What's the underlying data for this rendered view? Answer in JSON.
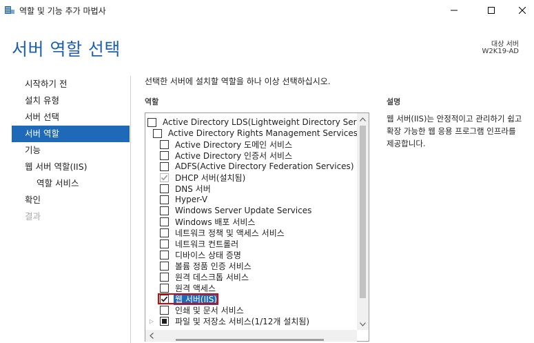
{
  "window": {
    "title": "역할 및 기능 추가 마법사"
  },
  "header": {
    "page_title": "서버 역할 선택",
    "target_label": "대상 서버",
    "target_server": "W2K19-AD"
  },
  "nav": {
    "items": [
      {
        "label": "시작하기 전",
        "state": "normal"
      },
      {
        "label": "설치 유형",
        "state": "normal"
      },
      {
        "label": "서버 선택",
        "state": "normal"
      },
      {
        "label": "서버 역할",
        "state": "active"
      },
      {
        "label": "기능",
        "state": "normal"
      },
      {
        "label": "웹 서버 역할(IIS)",
        "state": "normal"
      },
      {
        "label": "역할 서비스",
        "state": "sub"
      },
      {
        "label": "확인",
        "state": "normal"
      },
      {
        "label": "결과",
        "state": "disabled"
      }
    ]
  },
  "main": {
    "instruction": "선택한 서버에 설치할 역할을 하나 이상 선택하십시오.",
    "roles_heading": "역할",
    "description_heading": "설명",
    "description_text": "웹 서버(IIS)는 안정적이고 관리하기 쉽고 확장 가능한 웹 응용 프로그램 인프라를 제공합니다.",
    "roles": [
      {
        "label": "Active Directory LDS(Lightweight Directory Services)",
        "checked": false
      },
      {
        "label": "Active Directory Rights Management Services",
        "checked": false
      },
      {
        "label": "Active Directory 도메인 서비스",
        "checked": false
      },
      {
        "label": "Active Directory 인증서 서비스",
        "checked": false
      },
      {
        "label": "ADFS(Active Directory Federation Services)",
        "checked": false
      },
      {
        "label": "DHCP 서버(설치됨)",
        "checked": "disabled"
      },
      {
        "label": "DNS 서버",
        "checked": false
      },
      {
        "label": "Hyper-V",
        "checked": false
      },
      {
        "label": "Windows Server Update Services",
        "checked": false
      },
      {
        "label": "Windows 배포 서비스",
        "checked": false
      },
      {
        "label": "네트워크 정책 및 액세스 서비스",
        "checked": false
      },
      {
        "label": "네트워크 컨트롤러",
        "checked": false
      },
      {
        "label": "디바이스 상태 증명",
        "checked": false
      },
      {
        "label": "볼륨 정품 인증 서비스",
        "checked": false
      },
      {
        "label": "원격 데스크톱 서비스",
        "checked": false
      },
      {
        "label": "원격 액세스",
        "checked": false
      },
      {
        "label": "웹 서버(IIS)",
        "checked": true,
        "selected": true
      },
      {
        "label": "인쇄 및 문서 서비스",
        "checked": false
      },
      {
        "label": "파일 및 저장소 서비스(1/12개 설치됨)",
        "checked": "partial",
        "expandable": true
      }
    ]
  },
  "colors": {
    "title_blue": "#1f5fb0",
    "nav_active_bg": "#1f6ab8",
    "selected_row_bg": "#1f6ab8",
    "highlight_red": "#e00000"
  }
}
